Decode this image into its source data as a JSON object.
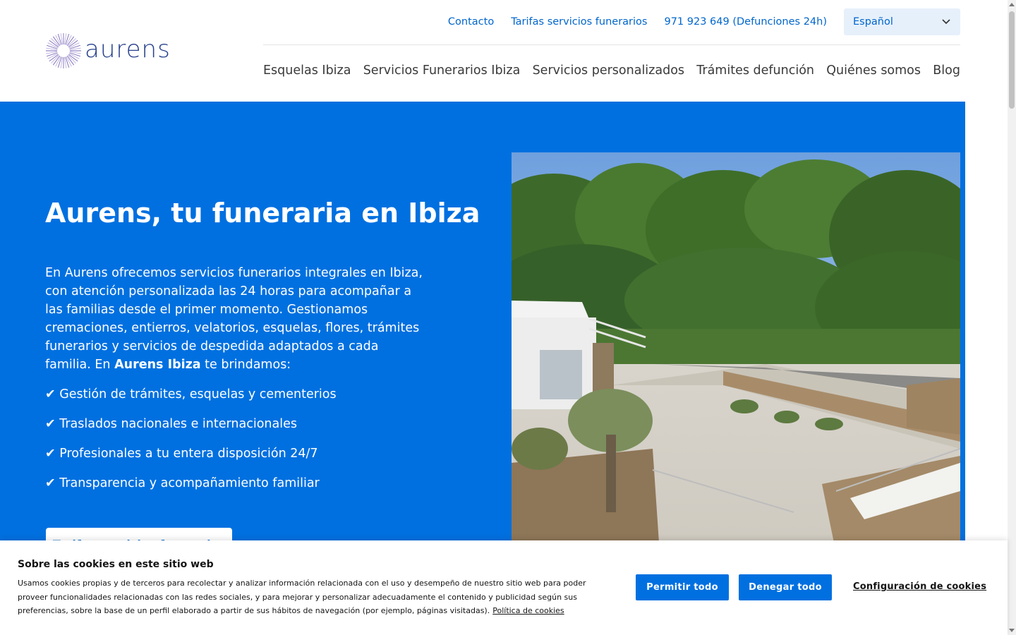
{
  "brand": {
    "logo_text": "aurens",
    "color": "#27408b"
  },
  "topbar": {
    "contact": "Contacto",
    "rates": "Tarifas servicios funerarios",
    "phone": "971 923 649 (Defunciones 24h)",
    "language": "Español"
  },
  "nav": {
    "items": [
      {
        "label": "Esquelas Ibiza"
      },
      {
        "label": "Servicios Funerarios Ibiza"
      },
      {
        "label": "Servicios personalizados"
      },
      {
        "label": "Trámites defunción"
      },
      {
        "label": "Quiénes somos"
      },
      {
        "label": "Blog"
      }
    ]
  },
  "hero": {
    "title": "Aurens, tu funeraria en Ibiza",
    "intro_before": "En Aurens ofrecemos servicios funerarios integrales en Ibiza, con atención personalizada las 24 horas para acompañar a las familias desde el primer momento. Gestionamos cremaciones, entierros, velatorios, esquelas, flores, trámites funerarios y servicios de despedida adaptados a cada familia. En ",
    "intro_bold": "Aurens Ibiza",
    "intro_after": " te brindamos:",
    "checks": [
      "✔ Gestión de trámites, esquelas y cementerios",
      "✔ Traslados nacionales e internacionales",
      "✔ Profesionales a tu entera disposición 24/7",
      "✔ Transparencia y acompañamiento familiar"
    ],
    "button": "Tarifas servicios funerarios",
    "accent_color": "#0070e0"
  },
  "cookie": {
    "title": "Sobre las cookies en este sitio web",
    "text": "Usamos cookies propias y de terceros para recolectar y analizar información relacionada con el uso y desempeño de nuestro sitio web para poder proveer funcionalidades relacionadas con las redes sociales, y para mejorar y personalizar adecuadamente el contenido y publicidad según sus preferencias, sobre la base de un perfil elaborado a partir de sus hábitos de navegación (por ejemplo, páginas visitadas).",
    "policy_link": "Política de cookies",
    "allow": "Permitir todo",
    "deny": "Denegar todo",
    "settings": "Configuración de cookies"
  }
}
